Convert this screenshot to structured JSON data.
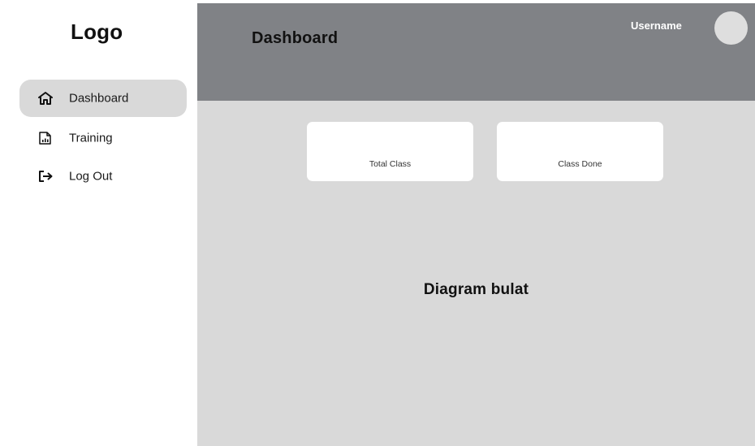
{
  "sidebar": {
    "logo": "Logo",
    "items": [
      {
        "label": "Dashboard",
        "icon": "home-icon",
        "active": true
      },
      {
        "label": "Training",
        "icon": "chart-document-icon",
        "active": false
      },
      {
        "label": "Log Out",
        "icon": "logout-icon",
        "active": false
      }
    ]
  },
  "header": {
    "title": "Dashboard",
    "username": "Username",
    "avatar_icon": "avatar"
  },
  "main": {
    "cards": [
      {
        "label": "Total Class"
      },
      {
        "label": "Class Done"
      }
    ],
    "chart_placeholder": "Diagram bulat"
  },
  "colors": {
    "topbar": "#808286",
    "main_background": "#d9d9d9",
    "active_nav": "#d9d9d9",
    "card": "#ffffff"
  }
}
